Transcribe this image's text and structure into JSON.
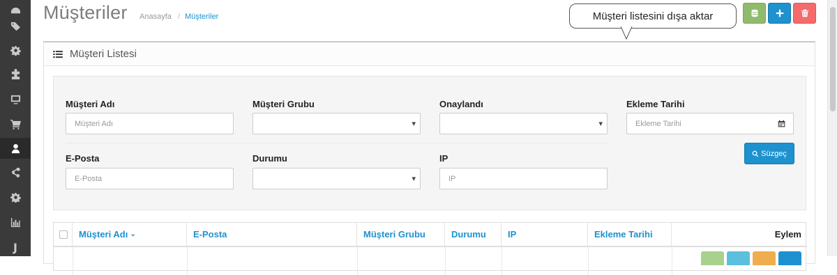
{
  "page": {
    "title": "Müşteriler",
    "breadcrumb": {
      "home": "Anasayfa",
      "separator": "/",
      "current": "Müşteriler"
    }
  },
  "sidebar": {
    "items": [
      {
        "icon": "dashboard-icon"
      },
      {
        "icon": "tags-icon"
      },
      {
        "icon": "gear-icon"
      },
      {
        "icon": "puzzle-icon"
      },
      {
        "icon": "monitor-icon"
      },
      {
        "icon": "shopping-cart-icon"
      },
      {
        "icon": "user-icon",
        "active": true
      },
      {
        "icon": "share-icon"
      },
      {
        "icon": "cog-icon"
      },
      {
        "icon": "bar-chart-icon"
      },
      {
        "icon": "joomla-icon",
        "label": "J"
      }
    ]
  },
  "header_actions": {
    "tooltip": "Müşteri listesini dışa aktar",
    "export_icon": "database-icon",
    "add_icon": "plus-icon",
    "delete_icon": "trash-icon",
    "colors": {
      "export": "#8fbb6c",
      "add": "#1e91cf",
      "delete": "#f56b6b"
    }
  },
  "panel": {
    "title": "Müşteri Listesi",
    "icon": "list-icon"
  },
  "filter": {
    "customer_name": {
      "label": "Müşteri Adı",
      "placeholder": "Müşteri Adı"
    },
    "customer_group": {
      "label": "Müşteri Grubu",
      "value": ""
    },
    "approved": {
      "label": "Onaylandı",
      "value": ""
    },
    "date_added": {
      "label": "Ekleme Tarihi",
      "placeholder": "Ekleme Tarihi"
    },
    "email": {
      "label": "E-Posta",
      "placeholder": "E-Posta"
    },
    "status": {
      "label": "Durumu",
      "value": ""
    },
    "ip": {
      "label": "IP",
      "placeholder": "IP"
    },
    "filter_button": "Süzgeç"
  },
  "table": {
    "columns": [
      "Müşteri Adı",
      "E-Posta",
      "Müşteri Grubu",
      "Durumu",
      "IP",
      "Ekleme Tarihi",
      "Eylem"
    ],
    "sort_indicator": "⌄",
    "row_action_colors": [
      "#a9d18e",
      "#5bc0de",
      "#f0ad4e",
      "#1e91cf"
    ]
  },
  "accent_color": "#1e91cf"
}
